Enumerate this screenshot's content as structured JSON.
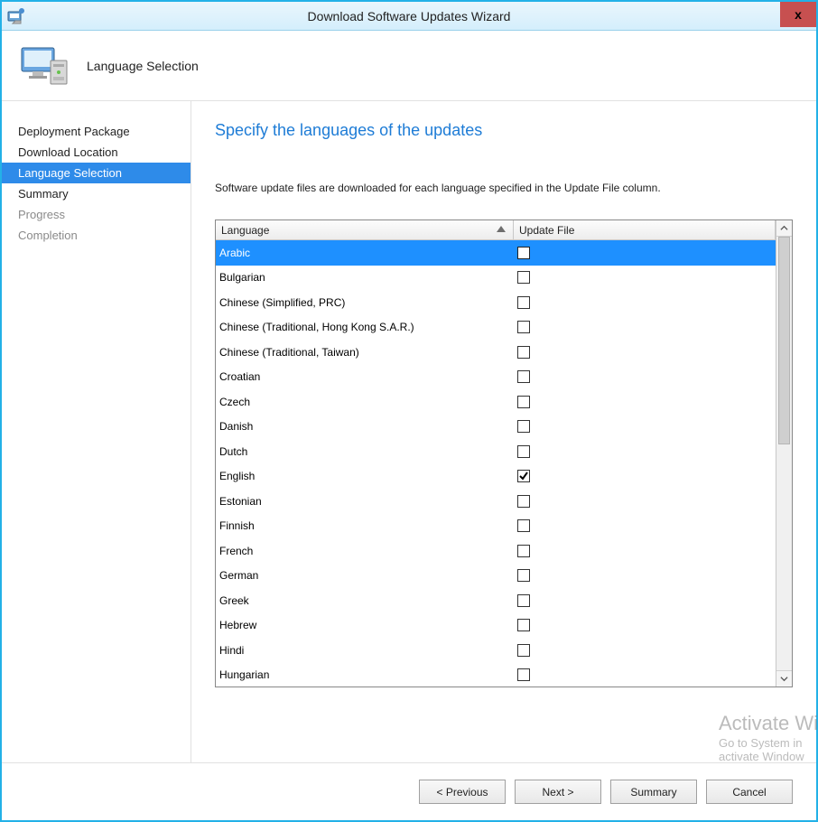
{
  "window": {
    "title": "Download Software Updates Wizard",
    "close_label": "x"
  },
  "header": {
    "page_title": "Language Selection"
  },
  "sidebar": {
    "items": [
      {
        "label": "Deployment Package",
        "state": "normal"
      },
      {
        "label": "Download Location",
        "state": "normal"
      },
      {
        "label": "Language Selection",
        "state": "selected"
      },
      {
        "label": "Summary",
        "state": "normal"
      },
      {
        "label": "Progress",
        "state": "disabled"
      },
      {
        "label": "Completion",
        "state": "disabled"
      }
    ]
  },
  "main": {
    "heading": "Specify the languages of the updates",
    "description": "Software update files are downloaded for each language specified in the Update File column.",
    "columns": {
      "language": "Language",
      "update_file": "Update File"
    },
    "rows": [
      {
        "lang": "Arabic",
        "checked": false,
        "selected": true
      },
      {
        "lang": "Bulgarian",
        "checked": false,
        "selected": false
      },
      {
        "lang": "Chinese (Simplified, PRC)",
        "checked": false,
        "selected": false
      },
      {
        "lang": "Chinese (Traditional, Hong Kong S.A.R.)",
        "checked": false,
        "selected": false
      },
      {
        "lang": "Chinese (Traditional, Taiwan)",
        "checked": false,
        "selected": false
      },
      {
        "lang": "Croatian",
        "checked": false,
        "selected": false
      },
      {
        "lang": "Czech",
        "checked": false,
        "selected": false
      },
      {
        "lang": "Danish",
        "checked": false,
        "selected": false
      },
      {
        "lang": "Dutch",
        "checked": false,
        "selected": false
      },
      {
        "lang": "English",
        "checked": true,
        "selected": false
      },
      {
        "lang": "Estonian",
        "checked": false,
        "selected": false
      },
      {
        "lang": "Finnish",
        "checked": false,
        "selected": false
      },
      {
        "lang": "French",
        "checked": false,
        "selected": false
      },
      {
        "lang": "German",
        "checked": false,
        "selected": false
      },
      {
        "lang": "Greek",
        "checked": false,
        "selected": false
      },
      {
        "lang": "Hebrew",
        "checked": false,
        "selected": false
      },
      {
        "lang": "Hindi",
        "checked": false,
        "selected": false
      },
      {
        "lang": "Hungarian",
        "checked": false,
        "selected": false
      }
    ]
  },
  "footer": {
    "previous": "< Previous",
    "next": "Next >",
    "summary": "Summary",
    "cancel": "Cancel"
  },
  "watermark": {
    "line1": "Activate Wi",
    "line2": "Go to System in",
    "line3": "activate Window"
  }
}
